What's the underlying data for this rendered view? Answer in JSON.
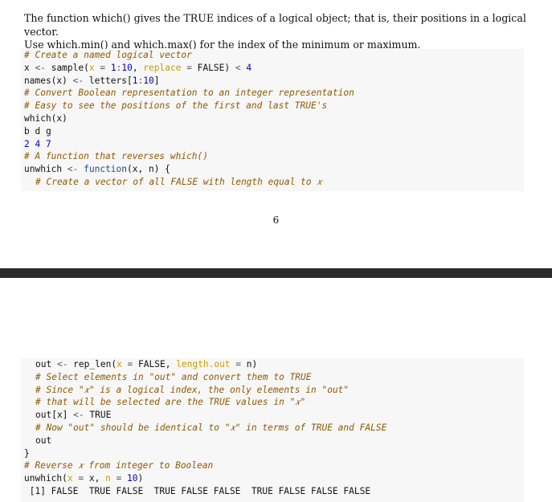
{
  "intro": {
    "line1": "The function which() gives the TRUE indices of a logical object; that is, their positions in a logical vector.",
    "line2": "Use which.min() and which.max() for the index of the minimum or maximum."
  },
  "code_top": {
    "c1": "# Create a named logical vector",
    "l2_a": "x ",
    "l2_b": "<-",
    "l2_c": " sample(",
    "l2_d": "x",
    "l2_e": " = ",
    "l2_f": "1",
    "l2_g": ":",
    "l2_h": "10",
    "l2_i": ", ",
    "l2_j": "replace",
    "l2_k": " = ",
    "l2_l": "FALSE) ",
    "l2_m": "<",
    "l2_n": " ",
    "l2_o": "4",
    "l3_a": "names(x) ",
    "l3_b": "<-",
    "l3_c": " letters[",
    "l3_d": "1",
    "l3_e": ":",
    "l3_f": "10",
    "l3_g": "]",
    "c4": "# Convert Boolean representation to an integer representation",
    "c5": "# Easy to see the positions of the first and last TRUE's",
    "l6": "which(x)",
    "o7": "b d g",
    "o8": "2 4 7",
    "c9": "# A function that reverses which()",
    "l10_a": "unwhich ",
    "l10_b": "<-",
    "l10_c": " ",
    "l10_d": "function",
    "l10_e": "(x, n) {",
    "c11": "# Create a vector of all FALSE with length equal to 𝑥"
  },
  "page_number": "6",
  "code_bottom": {
    "l1_a": "out ",
    "l1_b": "<-",
    "l1_c": " rep_len(",
    "l1_d": "x",
    "l1_e": " = ",
    "l1_f": "FALSE, ",
    "l1_g": "length.out",
    "l1_h": " = ",
    "l1_i": "n)",
    "c2": "# Select elements in \"out\" and convert them to TRUE",
    "c3": "# Since \"𝑥\" is a logical index, the only elements in \"out\"",
    "c4": "# that will be selected are the TRUE values in \"𝑥\"",
    "l5_a": "out[x] ",
    "l5_b": "<-",
    "l5_c": " TRUE",
    "c6": "# Now \"out\" should be identical to \"𝑥\" in terms of TRUE and FALSE",
    "l7": "out",
    "l8": "}",
    "c9": "# Reverse 𝑥 from integer to Boolean",
    "l10_a": "unwhich(",
    "l10_b": "x",
    "l10_c": " = ",
    "l10_d": "x, ",
    "l10_e": "n",
    "l10_f": " = ",
    "l10_g": "10",
    "l10_h": ")",
    "o11": " [1] FALSE  TRUE FALSE  TRUE FALSE FALSE  TRUE FALSE FALSE FALSE"
  }
}
